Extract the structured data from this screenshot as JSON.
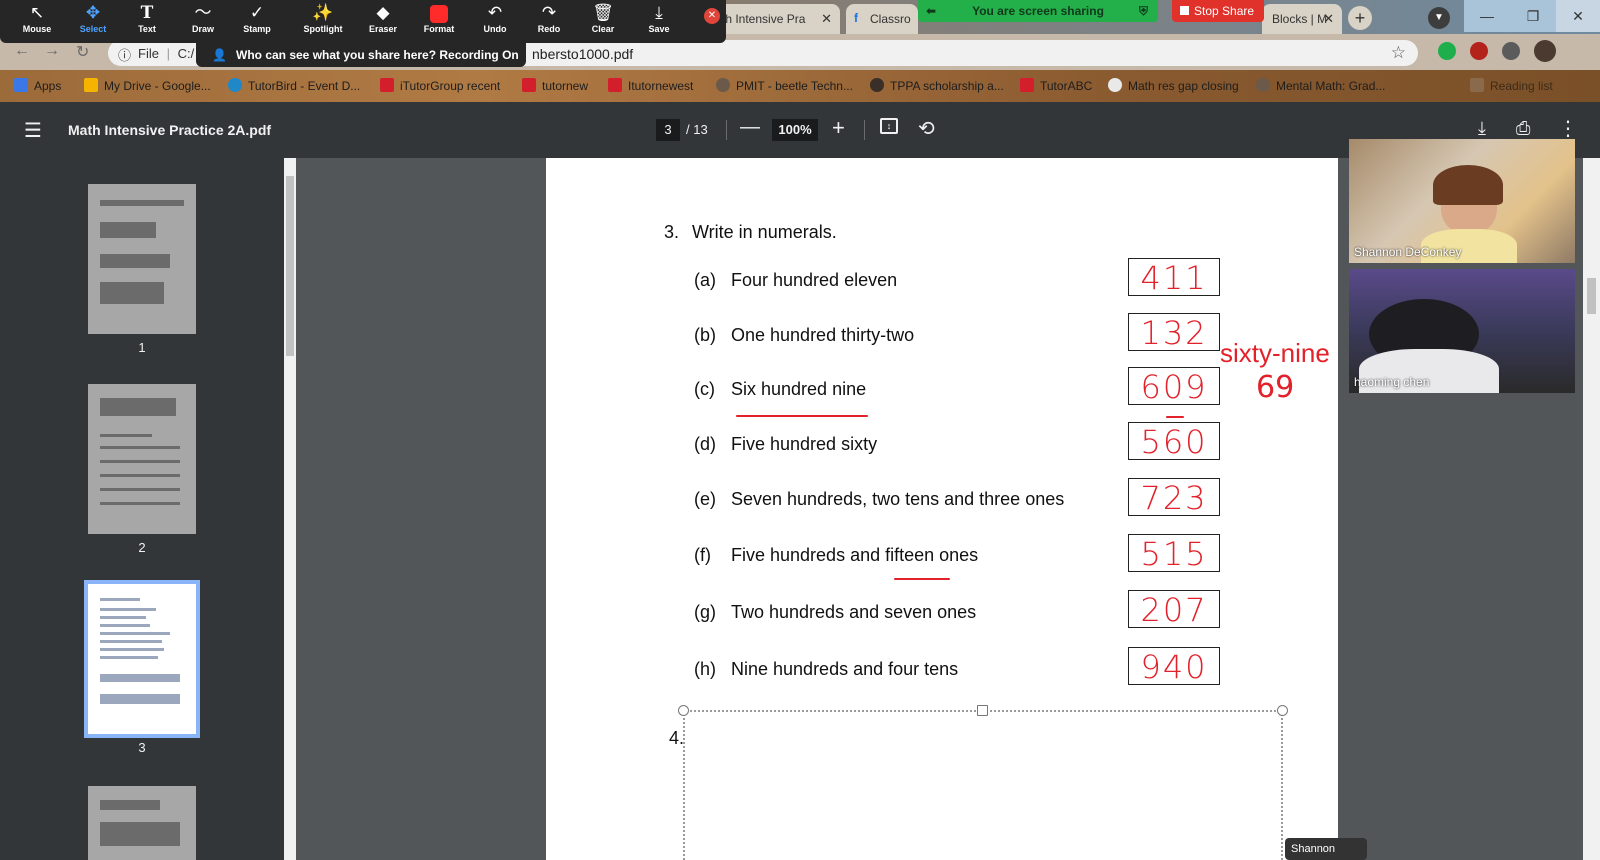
{
  "browser": {
    "tabs": [
      {
        "label": "th Intensive Pra"
      },
      {
        "label": "Classro"
      },
      {
        "label": "Blocks | M"
      }
    ],
    "address": {
      "file_label": "File",
      "path_prefix": "C:/",
      "url_tail": "nbersto1000.pdf"
    },
    "bookmarks": [
      "Apps",
      "My Drive - Google...",
      "TutorBird - Event D...",
      "iTutorGroup recent",
      "tutornew",
      "Itutornewest",
      "PMIT - beetle Techn...",
      "TPPA scholarship a...",
      "TutorABC",
      "Math res gap closing",
      "Mental Math: Grad..."
    ],
    "reading_list": "Reading list"
  },
  "zoom": {
    "tools": [
      {
        "name": "mouse",
        "label": "Mouse",
        "icon": "↖"
      },
      {
        "name": "select",
        "label": "Select",
        "icon": "✥"
      },
      {
        "name": "text",
        "label": "Text",
        "icon": "T"
      },
      {
        "name": "draw",
        "label": "Draw",
        "icon": "〜"
      },
      {
        "name": "stamp",
        "label": "Stamp",
        "icon": "✓"
      },
      {
        "name": "spotlight",
        "label": "Spotlight",
        "icon": "✨"
      },
      {
        "name": "eraser",
        "label": "Eraser",
        "icon": "◆"
      },
      {
        "name": "format",
        "label": "Format",
        "icon": ""
      },
      {
        "name": "undo",
        "label": "Undo",
        "icon": "↶"
      },
      {
        "name": "redo",
        "label": "Redo",
        "icon": "↷"
      },
      {
        "name": "clear",
        "label": "Clear",
        "icon": "🗑"
      },
      {
        "name": "save",
        "label": "Save",
        "icon": "⤓"
      }
    ],
    "who_can_see": "Who can see what you share here? Recording On",
    "sharing_banner": "You are screen sharing",
    "stop_share": "Stop Share",
    "speaker_chip": "Shannon DeC...",
    "participants": [
      {
        "name": "Shannon DeConkey"
      },
      {
        "name": "haoming  chen"
      }
    ],
    "accent": "#e0322b",
    "share_green": "#23b04a"
  },
  "pdf": {
    "title": "Math Intensive Practice 2A.pdf",
    "page_current": "3",
    "page_total": "/ 13",
    "zoom": "100%",
    "thumbnails": [
      "1",
      "2",
      "3"
    ]
  },
  "worksheet": {
    "q3_number": "3.",
    "q3_title": "Write in numerals.",
    "items": [
      {
        "label": "(a)",
        "text": "Four hundred eleven",
        "answer": "411"
      },
      {
        "label": "(b)",
        "text": "One hundred thirty-two",
        "answer": "132"
      },
      {
        "label": "(c)",
        "text": "Six hundred nine",
        "answer": "609"
      },
      {
        "label": "(d)",
        "text": "Five hundred sixty",
        "answer": "560"
      },
      {
        "label": "(e)",
        "text": "Seven hundreds, two tens and three ones",
        "answer": "723"
      },
      {
        "label": "(f)",
        "text": "Five hundreds and fifteen ones",
        "answer": "515"
      },
      {
        "label": "(g)",
        "text": "Two hundreds and seven ones",
        "answer": "207"
      },
      {
        "label": "(h)",
        "text": "Nine hundreds and four tens",
        "answer": "940"
      }
    ],
    "note_text": "sixty-nine",
    "note_number": "69",
    "q4_number": "4.",
    "ink_color": "#e2212a"
  }
}
